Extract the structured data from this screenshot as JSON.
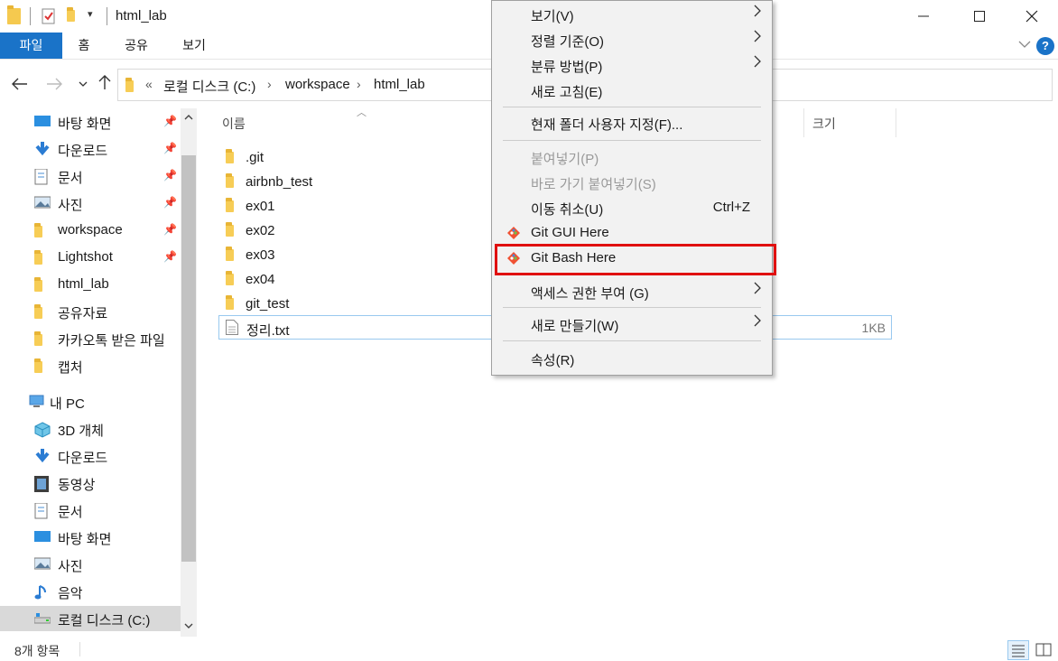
{
  "window": {
    "title": "html_lab",
    "controls": {
      "minimize": "─",
      "maximize": "☐",
      "close": "✕"
    }
  },
  "ribbon": {
    "tabs": [
      {
        "label": "파일",
        "active": true
      },
      {
        "label": "홈"
      },
      {
        "label": "공유"
      },
      {
        "label": "보기"
      }
    ],
    "help": "?"
  },
  "address": {
    "overflow": "«",
    "crumbs": [
      "로컬 디스크 (C:)",
      "workspace",
      "html_lab"
    ]
  },
  "nav_pane": {
    "quick_access": [
      {
        "label": "바탕 화면",
        "icon": "desktop-icon",
        "pinned": true
      },
      {
        "label": "다운로드",
        "icon": "download-icon",
        "pinned": true
      },
      {
        "label": "문서",
        "icon": "document-icon",
        "pinned": true
      },
      {
        "label": "사진",
        "icon": "picture-icon",
        "pinned": true
      },
      {
        "label": "workspace",
        "icon": "folder-icon",
        "pinned": true
      },
      {
        "label": "Lightshot",
        "icon": "folder-icon",
        "pinned": true
      },
      {
        "label": "html_lab",
        "icon": "folder-icon",
        "pinned": false
      },
      {
        "label": "공유자료",
        "icon": "folder-icon",
        "pinned": false
      },
      {
        "label": "카카오톡 받은 파일",
        "icon": "folder-icon",
        "pinned": false
      },
      {
        "label": "캡처",
        "icon": "folder-icon",
        "pinned": false
      }
    ],
    "this_pc": {
      "label": "내 PC",
      "icon": "pc-icon"
    },
    "pc_items": [
      {
        "label": "3D 개체",
        "icon": "cube-icon"
      },
      {
        "label": "다운로드",
        "icon": "download-icon"
      },
      {
        "label": "동영상",
        "icon": "video-icon"
      },
      {
        "label": "문서",
        "icon": "document-icon"
      },
      {
        "label": "바탕 화면",
        "icon": "desktop-icon"
      },
      {
        "label": "사진",
        "icon": "picture-icon"
      },
      {
        "label": "음악",
        "icon": "music-icon"
      },
      {
        "label": "로컬 디스크 (C:)",
        "icon": "drive-icon",
        "selected": true
      }
    ]
  },
  "file_list": {
    "headers": {
      "name": "이름",
      "size": "크기"
    },
    "items": [
      {
        "name": ".git",
        "type": "folder"
      },
      {
        "name": "airbnb_test",
        "type": "folder"
      },
      {
        "name": "ex01",
        "type": "folder"
      },
      {
        "name": "ex02",
        "type": "folder"
      },
      {
        "name": "ex03",
        "type": "folder"
      },
      {
        "name": "ex04",
        "type": "folder"
      },
      {
        "name": "git_test",
        "type": "folder"
      },
      {
        "name": "정리.txt",
        "type": "file",
        "size": "1KB"
      }
    ]
  },
  "status_bar": {
    "count": "8개 항목"
  },
  "context_menu": {
    "items": [
      {
        "label": "보기(V)",
        "submenu": true
      },
      {
        "label": "정렬 기준(O)",
        "submenu": true
      },
      {
        "label": "분류 방법(P)",
        "submenu": true
      },
      {
        "label": "새로 고침(E)"
      },
      {
        "label": "현재 폴더 사용자 지정(F)..."
      },
      {
        "label": "붙여넣기(P)",
        "disabled": true
      },
      {
        "label": "바로 가기 붙여넣기(S)",
        "disabled": true
      },
      {
        "label": "이동 취소(U)",
        "shortcut": "Ctrl+Z"
      },
      {
        "label": "Git GUI Here",
        "icon": "git-icon"
      },
      {
        "label": "Git Bash Here",
        "icon": "git-icon",
        "highlighted": true
      },
      {
        "label": "액세스 권한 부여 (G)",
        "submenu": true
      },
      {
        "label": "새로 만들기(W)",
        "submenu": true
      },
      {
        "label": "속성(R)"
      }
    ]
  },
  "colors": {
    "accent": "#1a73c8",
    "highlight_border": "#e01010",
    "folder": "#f5c94f"
  }
}
